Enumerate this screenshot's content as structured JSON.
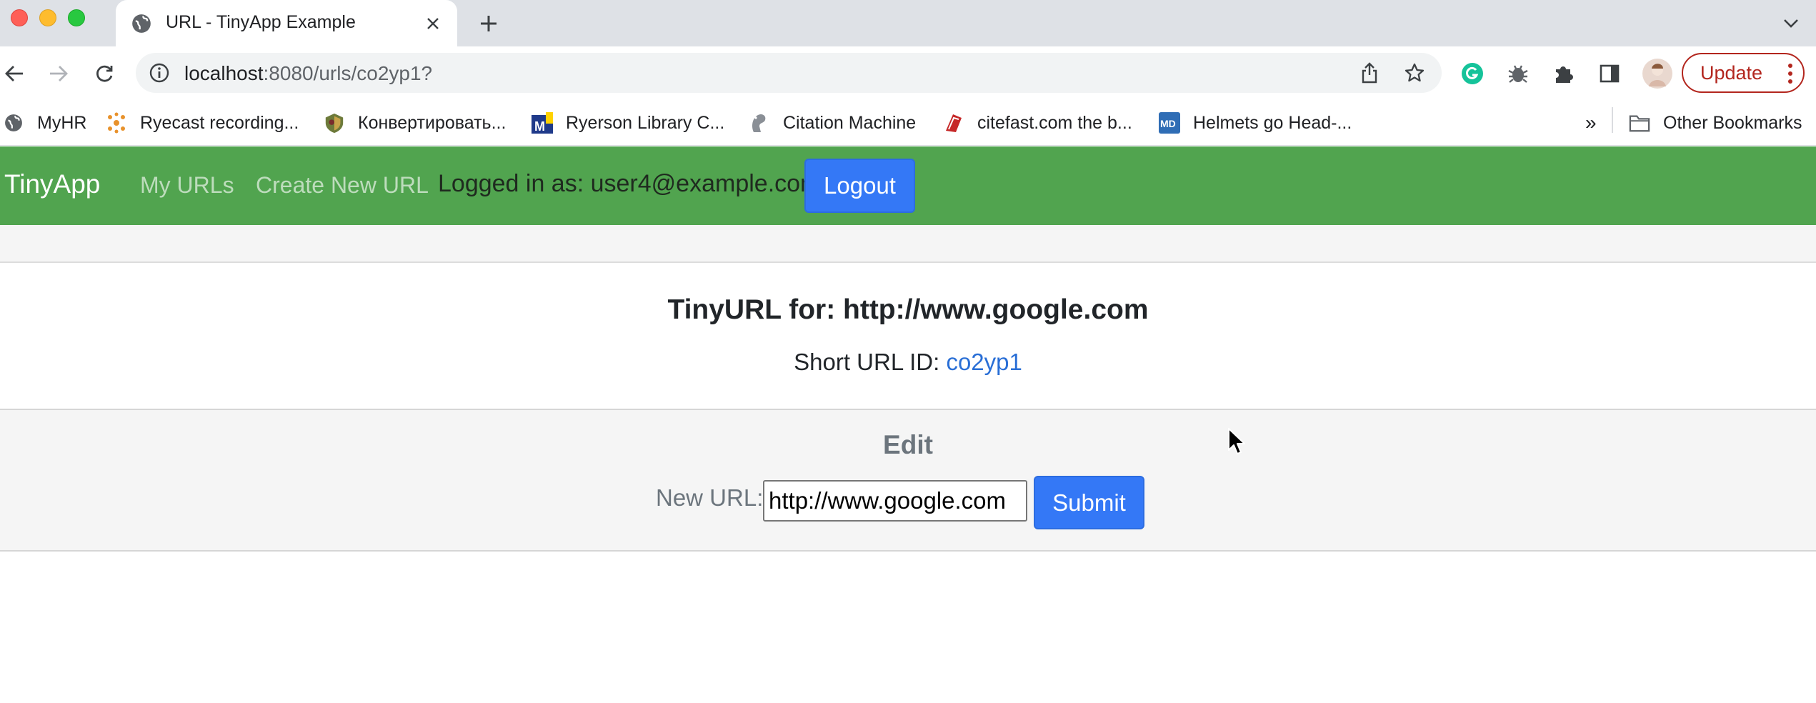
{
  "browser": {
    "tab_title": "URL - TinyApp Example",
    "url_host": "localhost",
    "url_path": ":8080/urls/co2yp1?",
    "update_label": "Update",
    "bookmarks": [
      {
        "label": "MyHR",
        "icon": "globe-icon"
      },
      {
        "label": "Ryecast recording...",
        "icon": "ryecast-icon"
      },
      {
        "label": "Конвертировать...",
        "icon": "shield-icon"
      },
      {
        "label": "Ryerson Library C...",
        "icon": "library-icon"
      },
      {
        "label": "Citation Machine",
        "icon": "squirrel-icon"
      },
      {
        "label": "citefast.com the b...",
        "icon": "citefast-icon"
      },
      {
        "label": "Helmets go Head-...",
        "icon": "md-icon"
      }
    ],
    "overflow_label": "»",
    "other_bookmarks_label": "Other Bookmarks"
  },
  "app": {
    "brand": "TinyApp",
    "nav": {
      "my_urls": "My URLs",
      "create_new": "Create New URL",
      "logged_in": "Logged in as: user4@example.com",
      "logout": "Logout"
    },
    "tinyurl_title": "TinyURL for: http://www.google.com",
    "short_id_label": "Short URL ID: ",
    "short_id": "co2yp1",
    "edit_title": "Edit",
    "new_url_label": "New URL:",
    "new_url_value": "http://www.google.com",
    "submit_label": "Submit"
  },
  "colors": {
    "navbar": "#51a44f",
    "primary_button": "#3478f6",
    "link": "#2a6fd6",
    "update_red": "#b3261e"
  }
}
